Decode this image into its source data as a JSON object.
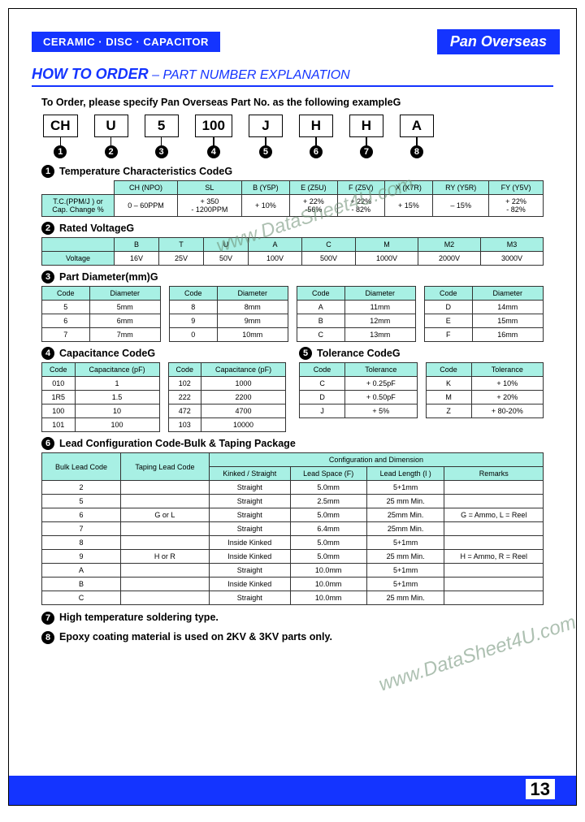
{
  "header": {
    "cdcap": "CERAMIC · DISC · CAPACITOR",
    "brand": "Pan Overseas"
  },
  "howToOrder": {
    "main": "HOW TO ORDER",
    "sub": " – PART NUMBER EXPLANATION"
  },
  "intro": "To Order, please specify Pan Overseas Part No. as the following exampleG",
  "part": [
    "CH",
    "U",
    "5",
    "100",
    "J",
    "H",
    "H",
    "A"
  ],
  "s1": {
    "title": "Temperature Characteristics CodeG",
    "cols": [
      "CH (NPO)",
      "SL",
      "B (Y5P)",
      "E (Z5U)",
      "F (Z5V)",
      "X (X7R)",
      "RY (Y5R)",
      "FY (Y5V)"
    ],
    "rowlbl": "T.C.(PPM/J ) or Cap. Change %",
    "vals": [
      "0 – 60PPM",
      "+ 350\n- 1200PPM",
      "+ 10%",
      "+ 22%\n-56%",
      "+ 22%\n- 82%",
      "+ 15%",
      "– 15%",
      "+ 22%\n- 82%"
    ]
  },
  "s2": {
    "title": "Rated VoltageG",
    "codes": [
      "B",
      "T",
      "U",
      "A",
      "C",
      "M",
      "M2",
      "M3"
    ],
    "volts": [
      "16V",
      "25V",
      "50V",
      "100V",
      "500V",
      "1000V",
      "2000V",
      "3000V"
    ],
    "voltlbl": "Voltage"
  },
  "s3": {
    "title": "Part Diameter(mm)G",
    "h": [
      "Code",
      "Diameter"
    ],
    "t": [
      [
        "5",
        "5mm"
      ],
      [
        "6",
        "6mm"
      ],
      [
        "7",
        "7mm"
      ],
      [
        "8",
        "8mm"
      ],
      [
        "9",
        "9mm"
      ],
      [
        "0",
        "10mm"
      ],
      [
        "A",
        "11mm"
      ],
      [
        "B",
        "12mm"
      ],
      [
        "C",
        "13mm"
      ],
      [
        "D",
        "14mm"
      ],
      [
        "E",
        "15mm"
      ],
      [
        "F",
        "16mm"
      ]
    ]
  },
  "s4": {
    "title": "Capacitance CodeG",
    "h": [
      "Code",
      "Capacitance (pF)"
    ],
    "t": [
      [
        "010",
        "1"
      ],
      [
        "1R5",
        "1.5"
      ],
      [
        "100",
        "10"
      ],
      [
        "101",
        "100"
      ],
      [
        "102",
        "1000"
      ],
      [
        "222",
        "2200"
      ],
      [
        "472",
        "4700"
      ],
      [
        "103",
        "10000"
      ]
    ]
  },
  "s5": {
    "title": "Tolerance CodeG",
    "h": [
      "Code",
      "Tolerance"
    ],
    "t": [
      [
        "C",
        "+ 0.25pF"
      ],
      [
        "D",
        "+ 0.50pF"
      ],
      [
        "J",
        "+ 5%"
      ],
      [
        "K",
        "+ 10%"
      ],
      [
        "M",
        "+ 20%"
      ],
      [
        "Z",
        "+ 80-20%"
      ]
    ]
  },
  "s6": {
    "title": "Lead Configuration Code-Bulk & Taping Package",
    "hdrA": "Configuration and Dimension",
    "h": [
      "Bulk Lead Code",
      "Taping Lead Code",
      "Kinked / Straight",
      "Lead Space (F)",
      "Lead Length (l )",
      "Remarks"
    ],
    "rows": [
      [
        "2",
        "",
        "Straight",
        "5.0mm",
        "5+1mm",
        ""
      ],
      [
        "5",
        "",
        "Straight",
        "2.5mm",
        "25 mm Min.",
        ""
      ],
      [
        "6",
        "G or L",
        "Straight",
        "5.0mm",
        "25mm Min.",
        "G = Ammo, L = Reel"
      ],
      [
        "7",
        "",
        "Straight",
        "6.4mm",
        "25mm Min.",
        ""
      ],
      [
        "8",
        "",
        "Inside Kinked",
        "5.0mm",
        "5+1mm",
        ""
      ],
      [
        "9",
        "H or R",
        "Inside Kinked",
        "5.0mm",
        "25 mm Min.",
        "H = Ammo, R = Reel"
      ],
      [
        "A",
        "",
        "Straight",
        "10.0mm",
        "5+1mm",
        ""
      ],
      [
        "B",
        "",
        "Inside Kinked",
        "10.0mm",
        "5+1mm",
        ""
      ],
      [
        "C",
        "",
        "Straight",
        "10.0mm",
        "25 mm Min.",
        ""
      ]
    ]
  },
  "s7": "High temperature soldering type.",
  "s8": "Epoxy coating material is used on 2KV & 3KV parts only.",
  "pageNo": "13",
  "wm": "www.DataSheet4U.com"
}
